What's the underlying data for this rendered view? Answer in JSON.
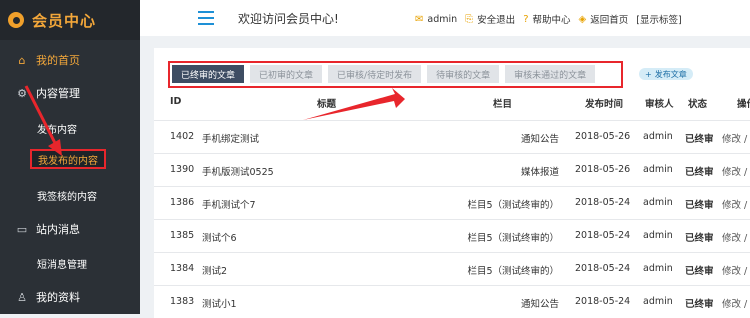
{
  "sidebar": {
    "brand": "会员中心",
    "items": [
      {
        "label": "我的首页",
        "icon": "home-icon",
        "glyph": "⌂"
      },
      {
        "label": "内容管理",
        "icon": "gear-icon",
        "glyph": "⚙"
      },
      {
        "label": "发布内容"
      },
      {
        "label": "我发布的内容"
      },
      {
        "label": "我签核的内容"
      },
      {
        "label": "站内消息",
        "icon": "message-icon",
        "glyph": "▭"
      },
      {
        "label": "短消息管理"
      },
      {
        "label": "我的资料",
        "icon": "user-icon",
        "glyph": "♙"
      }
    ]
  },
  "header": {
    "welcome": "欢迎访问会员中心!",
    "username": "admin",
    "logout": "安全退出",
    "help": "帮助中心",
    "back_home": "返回首页",
    "display_tag": "[显示标签]"
  },
  "tabs": [
    "已终审的文章",
    "已初审的文章",
    "已审核/待定时发布",
    "待审核的文章",
    "审核未通过的文章"
  ],
  "publish_button": "发布文章",
  "table": {
    "headers": {
      "id": "ID",
      "title": "标题",
      "column": "栏目",
      "time": "发布时间",
      "reviewer": "审核人",
      "status": "状态",
      "ops": "操作"
    },
    "rows": [
      {
        "id": "1402",
        "title": "手机绑定测试",
        "column": "通知公告",
        "time": "2018-05-26",
        "reviewer": "admin",
        "status": "已终审",
        "ops": "修改 /"
      },
      {
        "id": "1390",
        "title": "手机版测试0525",
        "column": "媒体报道",
        "time": "2018-05-26",
        "reviewer": "admin",
        "status": "已终审",
        "ops": "修改 /"
      },
      {
        "id": "1386",
        "title": "手机测试个7",
        "column": "栏目5（测试终审的）",
        "time": "2018-05-24",
        "reviewer": "admin",
        "status": "已终审",
        "ops": "修改 /"
      },
      {
        "id": "1385",
        "title": "测试个6",
        "column": "栏目5（测试终审的）",
        "time": "2018-05-24",
        "reviewer": "admin",
        "status": "已终审",
        "ops": "修改 /"
      },
      {
        "id": "1384",
        "title": "测试2",
        "column": "栏目5（测试终审的）",
        "time": "2018-05-24",
        "reviewer": "admin",
        "status": "已终审",
        "ops": "修改 /"
      },
      {
        "id": "1383",
        "title": "测试小1",
        "column": "通知公告",
        "time": "2018-05-24",
        "reviewer": "admin",
        "status": "已终审",
        "ops": "修改 /"
      }
    ]
  },
  "colors": {
    "accent": "#f3a73a",
    "highlight": "#e8262c",
    "sidebar_bg": "#2b3036",
    "tab_active": "#3e4d63"
  }
}
